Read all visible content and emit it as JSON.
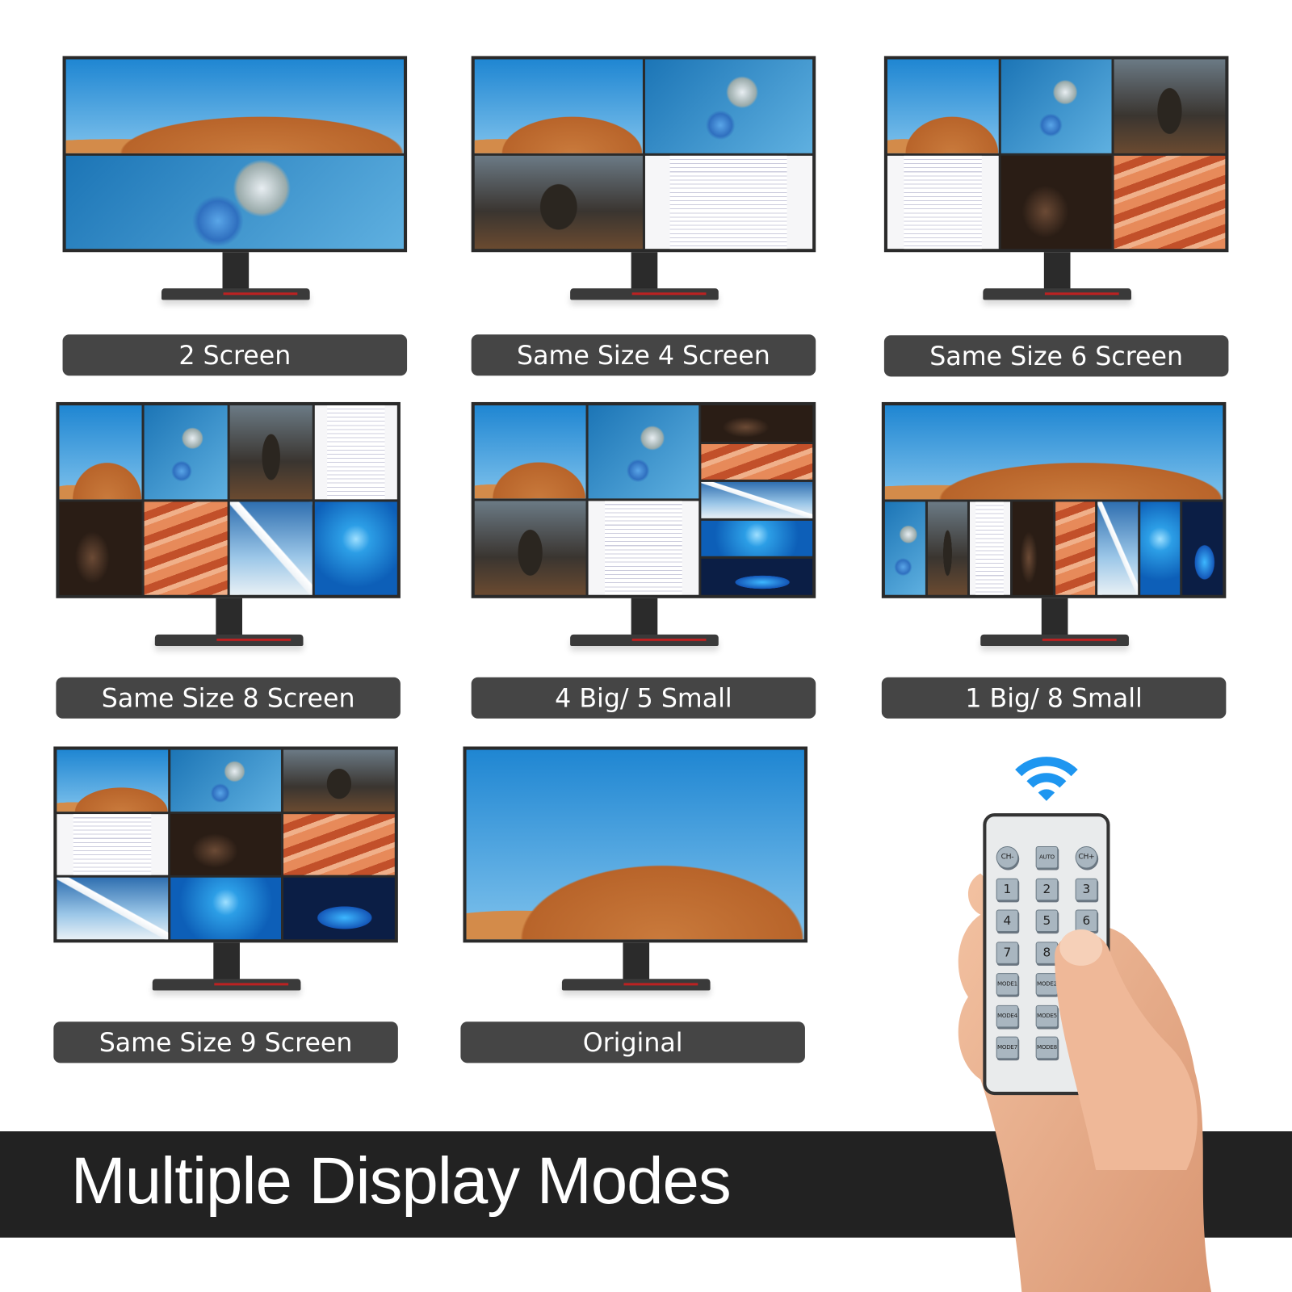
{
  "modes": [
    {
      "label": "2 Screen"
    },
    {
      "label": "Same Size 4 Screen"
    },
    {
      "label": "Same Size 6 Screen"
    },
    {
      "label": "Same Size 8 Screen"
    },
    {
      "label": "4 Big/ 5 Small"
    },
    {
      "label": "1 Big/ 8 Small"
    },
    {
      "label": "Same Size 9 Screen"
    },
    {
      "label": "Original"
    }
  ],
  "banner": {
    "title": "Multiple Display Modes"
  },
  "remote": {
    "buttons": [
      "CH-",
      "AUTO",
      "CH+",
      "1",
      "2",
      "3",
      "4",
      "5",
      "6",
      "7",
      "8",
      "",
      "MODE1",
      "MODE2",
      "",
      "MODE4",
      "MODE5",
      "",
      "MODE7",
      "MODE8",
      ""
    ]
  },
  "colors": {
    "wifi": "#1e96f0",
    "label_bg": "#454545",
    "banner_bg": "#222222"
  },
  "icons": {
    "signal": "wifi-icon"
  }
}
